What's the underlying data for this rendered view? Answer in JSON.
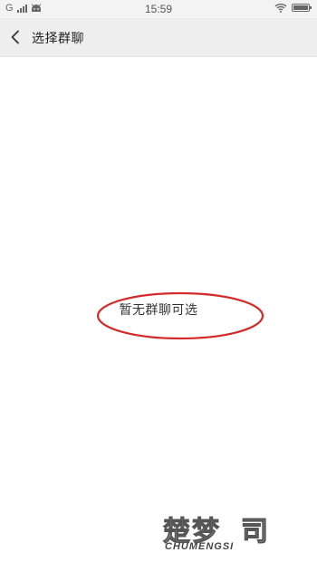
{
  "status_bar": {
    "carrier": "G",
    "signal_bars": 4,
    "time": "15:59",
    "battery_level": 1.0,
    "icons": [
      "signal-icon",
      "android-icon",
      "wifi-icon",
      "battery-icon"
    ]
  },
  "nav": {
    "back_icon": "chevron-left-icon",
    "title": "选择群聊"
  },
  "main": {
    "empty_message": "暂无群聊可选",
    "highlight_color": "#d42a2a"
  },
  "watermark": {
    "logo_text_cn": "楚梦",
    "logo_char": "司",
    "logo_text_en": "CHUMENGSI"
  },
  "colors": {
    "nav_background": "#eeeeee",
    "status_background": "#f3f3f3",
    "page_background": "#ffffff"
  }
}
